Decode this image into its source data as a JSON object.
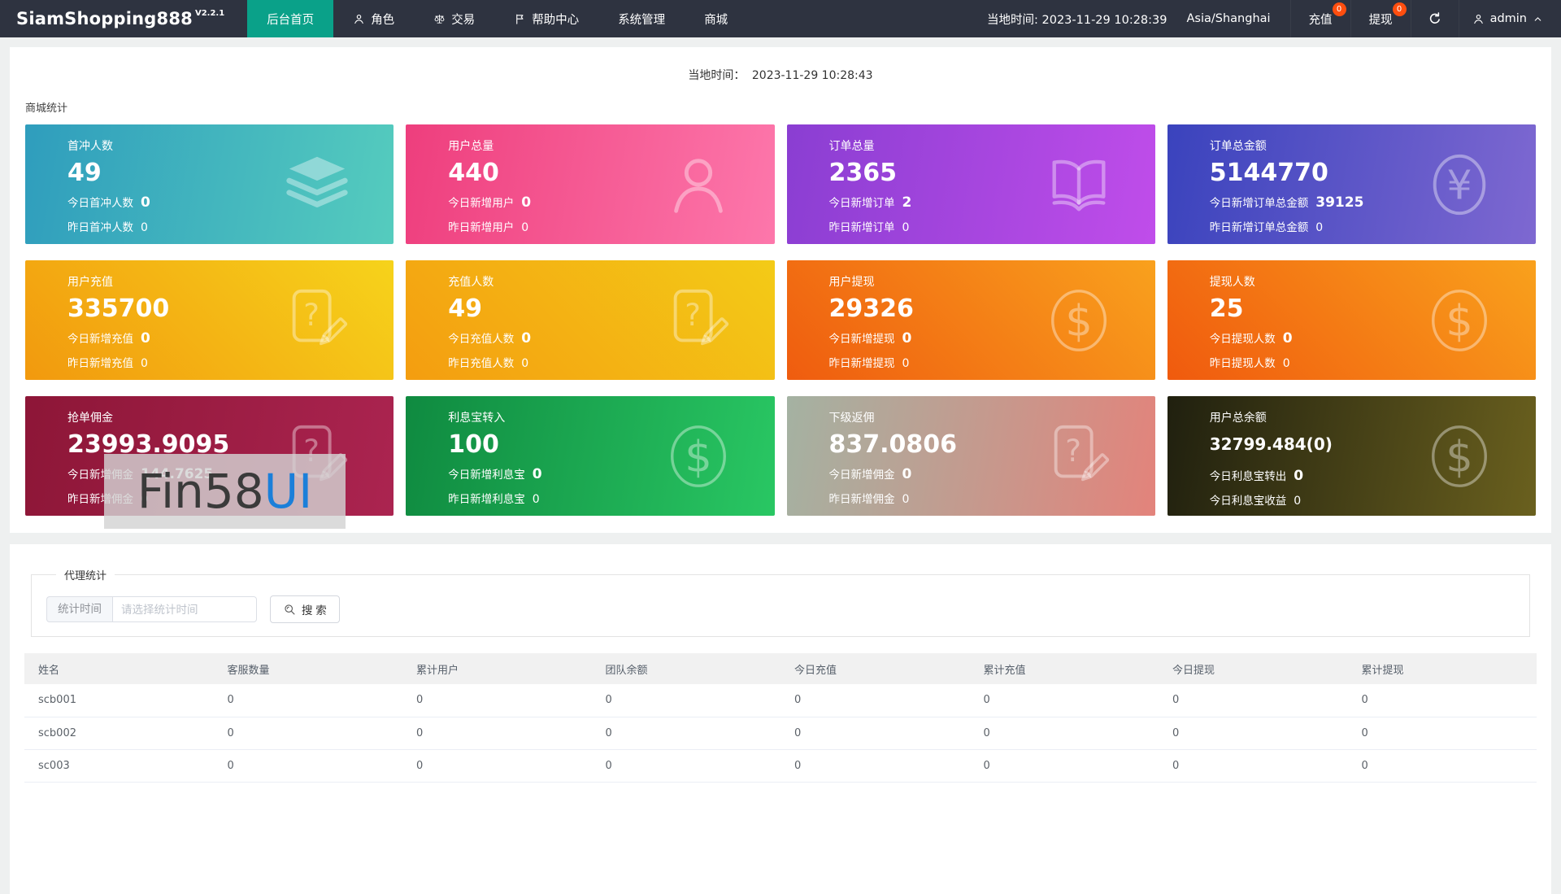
{
  "navbar": {
    "brand": "SiamShopping888",
    "version": "V2.2.1",
    "menu": [
      {
        "key": "home",
        "label": "后台首页",
        "icon": null,
        "active": true
      },
      {
        "key": "roles",
        "label": "角色",
        "icon": "person",
        "active": false
      },
      {
        "key": "trade",
        "label": "交易",
        "icon": "scales",
        "active": false
      },
      {
        "key": "help",
        "label": "帮助中心",
        "icon": "flag",
        "active": false
      },
      {
        "key": "system",
        "label": "系统管理",
        "icon": null,
        "active": false
      },
      {
        "key": "mall",
        "label": "商城",
        "icon": null,
        "active": false
      }
    ],
    "local_time": "当地时间: 2023-11-29 10:28:39",
    "timezone": "Asia/Shanghai",
    "recharge_label": "充值",
    "recharge_badge": "0",
    "withdraw_label": "提现",
    "withdraw_badge": "0",
    "refresh_icon": "refresh",
    "user": "admin",
    "user_icon": "person",
    "user_caret_icon": "chevron-up",
    "colors": {
      "bar_bg": "#2e3340",
      "active_tab": "#0aa189",
      "badge": "#ff4e0f"
    }
  },
  "stats_panel": {
    "time_label": "当地时间：",
    "time_value": "2023-11-29 10:28:43",
    "section_title": "商城统计",
    "cards": [
      {
        "key": "first-charge-users",
        "title": "首冲人数",
        "value": "49",
        "today_label": "今日首冲人数",
        "today_value": "0",
        "yesterday_label": "昨日首冲人数",
        "yesterday_value": "0",
        "icon": "layers",
        "gradient": {
          "angle": "100deg",
          "from": "#2f9dbd",
          "to": "#55ccbe"
        }
      },
      {
        "key": "total-users",
        "title": "用户总量",
        "value": "440",
        "today_label": "今日新增用户",
        "today_value": "0",
        "yesterday_label": "昨日新增用户",
        "yesterday_value": "0",
        "icon": "user",
        "gradient": {
          "angle": "100deg",
          "from": "#ee3e7d",
          "to": "#fd77ab"
        }
      },
      {
        "key": "total-orders",
        "title": "订单总量",
        "value": "2365",
        "today_label": "今日新增订单",
        "today_value": "2",
        "yesterday_label": "昨日新增订单",
        "yesterday_value": "0",
        "icon": "book",
        "gradient": {
          "angle": "100deg",
          "from": "#8a3ed2",
          "to": "#c04dea"
        }
      },
      {
        "key": "order-total-amount",
        "title": "订单总金额",
        "value": "5144770",
        "today_label": "今日新增订单总金额",
        "today_value": "39125",
        "yesterday_label": "昨日新增订单总金额",
        "yesterday_value": "0",
        "icon": "yen",
        "gradient": {
          "angle": "100deg",
          "from": "#3a43bd",
          "to": "#7e68d1"
        }
      },
      {
        "key": "user-recharge",
        "title": "用户充值",
        "value": "335700",
        "today_label": "今日新增充值",
        "today_value": "0",
        "yesterday_label": "昨日新增充值",
        "yesterday_value": "0",
        "icon": "doc-question",
        "gradient": {
          "angle": "45deg",
          "from": "#f2990e",
          "to": "#f6d31b"
        }
      },
      {
        "key": "recharge-users",
        "title": "充值人数",
        "value": "49",
        "today_label": "今日充值人数",
        "today_value": "0",
        "yesterday_label": "昨日充值人数",
        "yesterday_value": "0",
        "icon": "doc-question",
        "gradient": {
          "angle": "45deg",
          "from": "#f49d10",
          "to": "#f3cb17"
        }
      },
      {
        "key": "user-withdraw",
        "title": "用户提现",
        "value": "29326",
        "today_label": "今日新增提现",
        "today_value": "0",
        "yesterday_label": "昨日新增提现",
        "yesterday_value": "0",
        "icon": "dollar",
        "gradient": {
          "angle": "45deg",
          "from": "#ef5c0f",
          "to": "#f9a11d"
        }
      },
      {
        "key": "withdraw-users",
        "title": "提现人数",
        "value": "25",
        "today_label": "今日提现人数",
        "today_value": "0",
        "yesterday_label": "昨日提现人数",
        "yesterday_value": "0",
        "icon": "dollar",
        "gradient": {
          "angle": "45deg",
          "from": "#f05a0e",
          "to": "#f9a11c"
        }
      },
      {
        "key": "order-commission",
        "title": "抢单佣金",
        "value": "23993.9095",
        "today_label": "今日新增佣金",
        "today_value": "144.7625",
        "yesterday_label": "昨日新增佣金",
        "yesterday_value": "0",
        "icon": "doc-question",
        "gradient": {
          "angle": "100deg",
          "from": "#8d1637",
          "to": "#ab2450"
        }
      },
      {
        "key": "interest-transfer-in",
        "title": "利息宝转入",
        "value": "100",
        "today_label": "今日新增利息宝",
        "today_value": "0",
        "yesterday_label": "昨日新增利息宝",
        "yesterday_value": "0",
        "icon": "dollar",
        "gradient": {
          "angle": "100deg",
          "from": "#0f8a40",
          "to": "#29c763"
        }
      },
      {
        "key": "subordinate-rebate",
        "title": "下级返佣",
        "value": "837.0806",
        "today_label": "今日新增佣金",
        "today_value": "0",
        "yesterday_label": "昨日新增佣金",
        "yesterday_value": "0",
        "icon": "doc-question",
        "gradient": {
          "angle": "100deg",
          "from": "#a4b2a2",
          "to": "#e3837b"
        }
      },
      {
        "key": "user-total-balance",
        "title": "用户总余额",
        "value": "32799.484(0)",
        "value_small": true,
        "today_label": "今日利息宝转出",
        "today_value": "0",
        "yesterday_label": "今日利息宝收益",
        "yesterday_value": "0",
        "icon": "dollar",
        "gradient": {
          "angle": "100deg",
          "from": "#20200f",
          "to": "#6a601e"
        }
      }
    ]
  },
  "watermark": {
    "text_dark": "Fin58",
    "text_blue": "UI",
    "blue_color": "#1b7fd9"
  },
  "agent_panel": {
    "legend": "代理统计",
    "time_field_label": "统计时间",
    "time_placeholder": "请选择统计时间",
    "search_label": "搜 索",
    "search_icon": "search",
    "table": {
      "headers": [
        "姓名",
        "客服数量",
        "累计用户",
        "团队余额",
        "今日充值",
        "累计充值",
        "今日提现",
        "累计提现"
      ],
      "rows": [
        [
          "scb001",
          "0",
          "0",
          "0",
          "0",
          "0",
          "0",
          "0"
        ],
        [
          "scb002",
          "0",
          "0",
          "0",
          "0",
          "0",
          "0",
          "0"
        ],
        [
          "sc003",
          "0",
          "0",
          "0",
          "0",
          "0",
          "0",
          "0"
        ]
      ]
    }
  }
}
